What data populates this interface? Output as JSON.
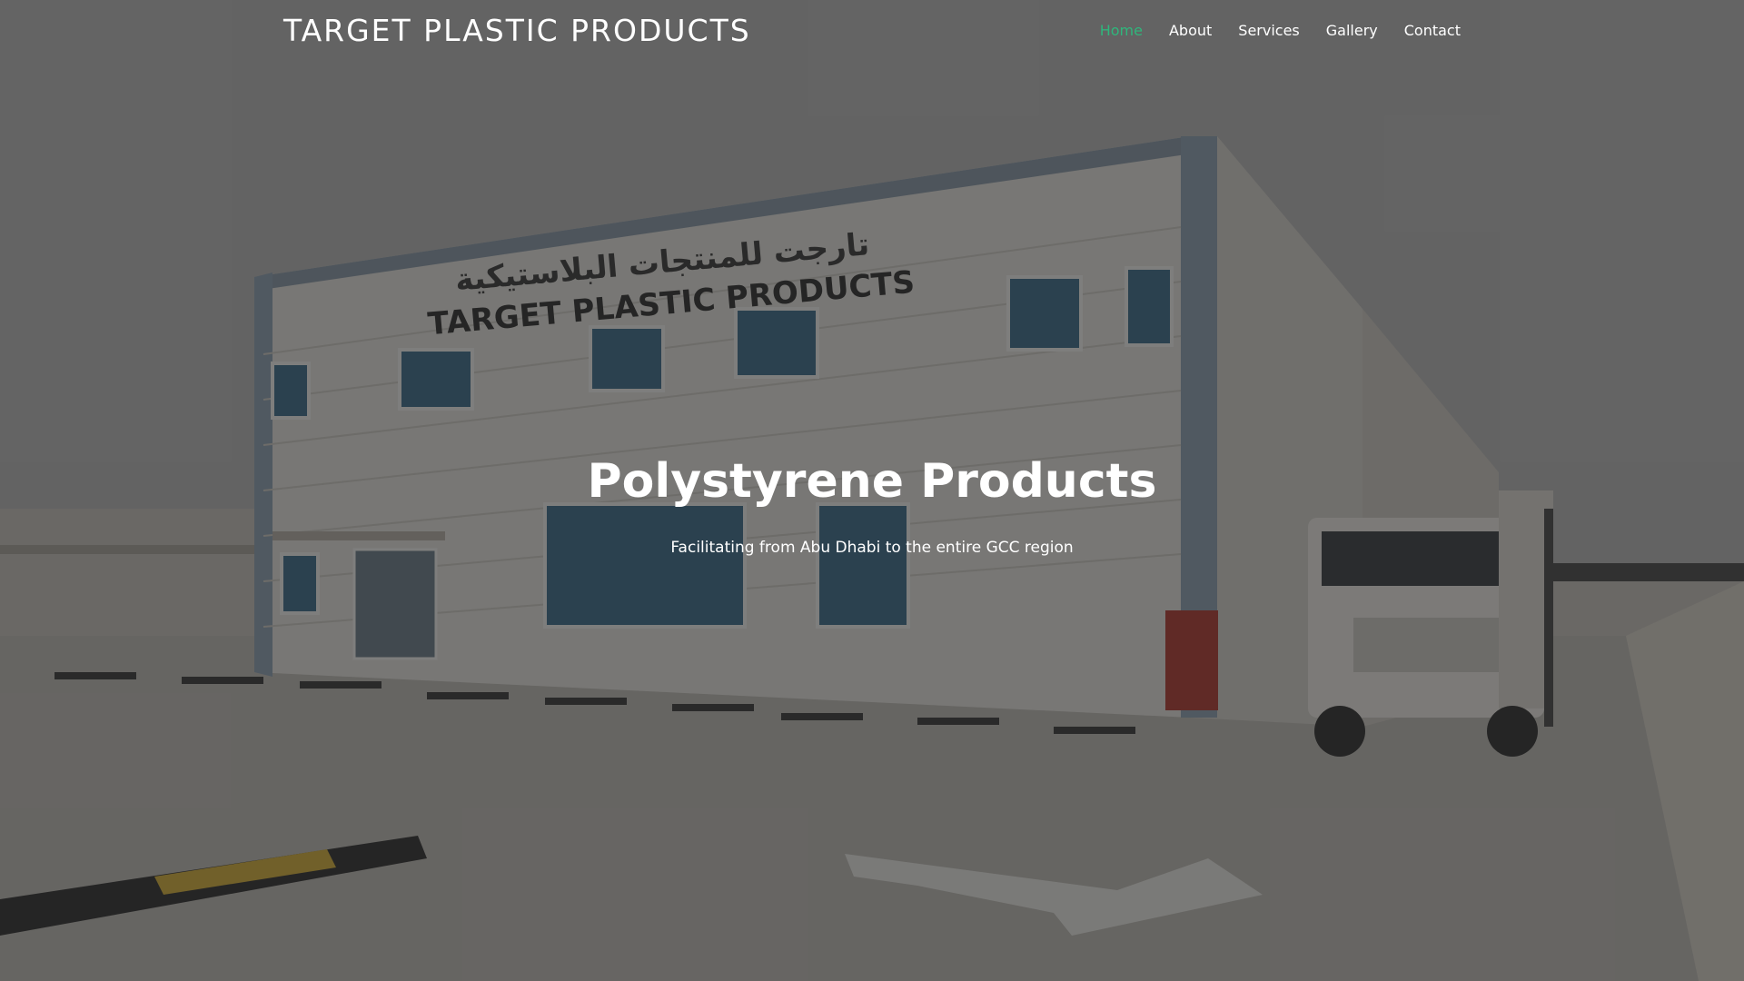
{
  "brand": {
    "name": "TARGET PLASTIC PRODUCTS"
  },
  "nav": {
    "items": [
      {
        "label": "Home",
        "active": true
      },
      {
        "label": "About",
        "active": false
      },
      {
        "label": "Services",
        "active": false
      },
      {
        "label": "Gallery",
        "active": false
      },
      {
        "label": "Contact",
        "active": false
      }
    ]
  },
  "hero": {
    "title": "Polystyrene Products",
    "subtitle": "Facilitating from Abu Dhabi to the entire GCC region",
    "image": {
      "subject": "factory-building-with-truck",
      "sign_arabic": "تارجت للمنتجات البلاستيكية",
      "sign_english": "TARGET PLASTIC PRODUCTS"
    }
  },
  "colors": {
    "accent": "#2fb67c",
    "text": "#ffffff",
    "overlay": "#1e1e1e"
  }
}
